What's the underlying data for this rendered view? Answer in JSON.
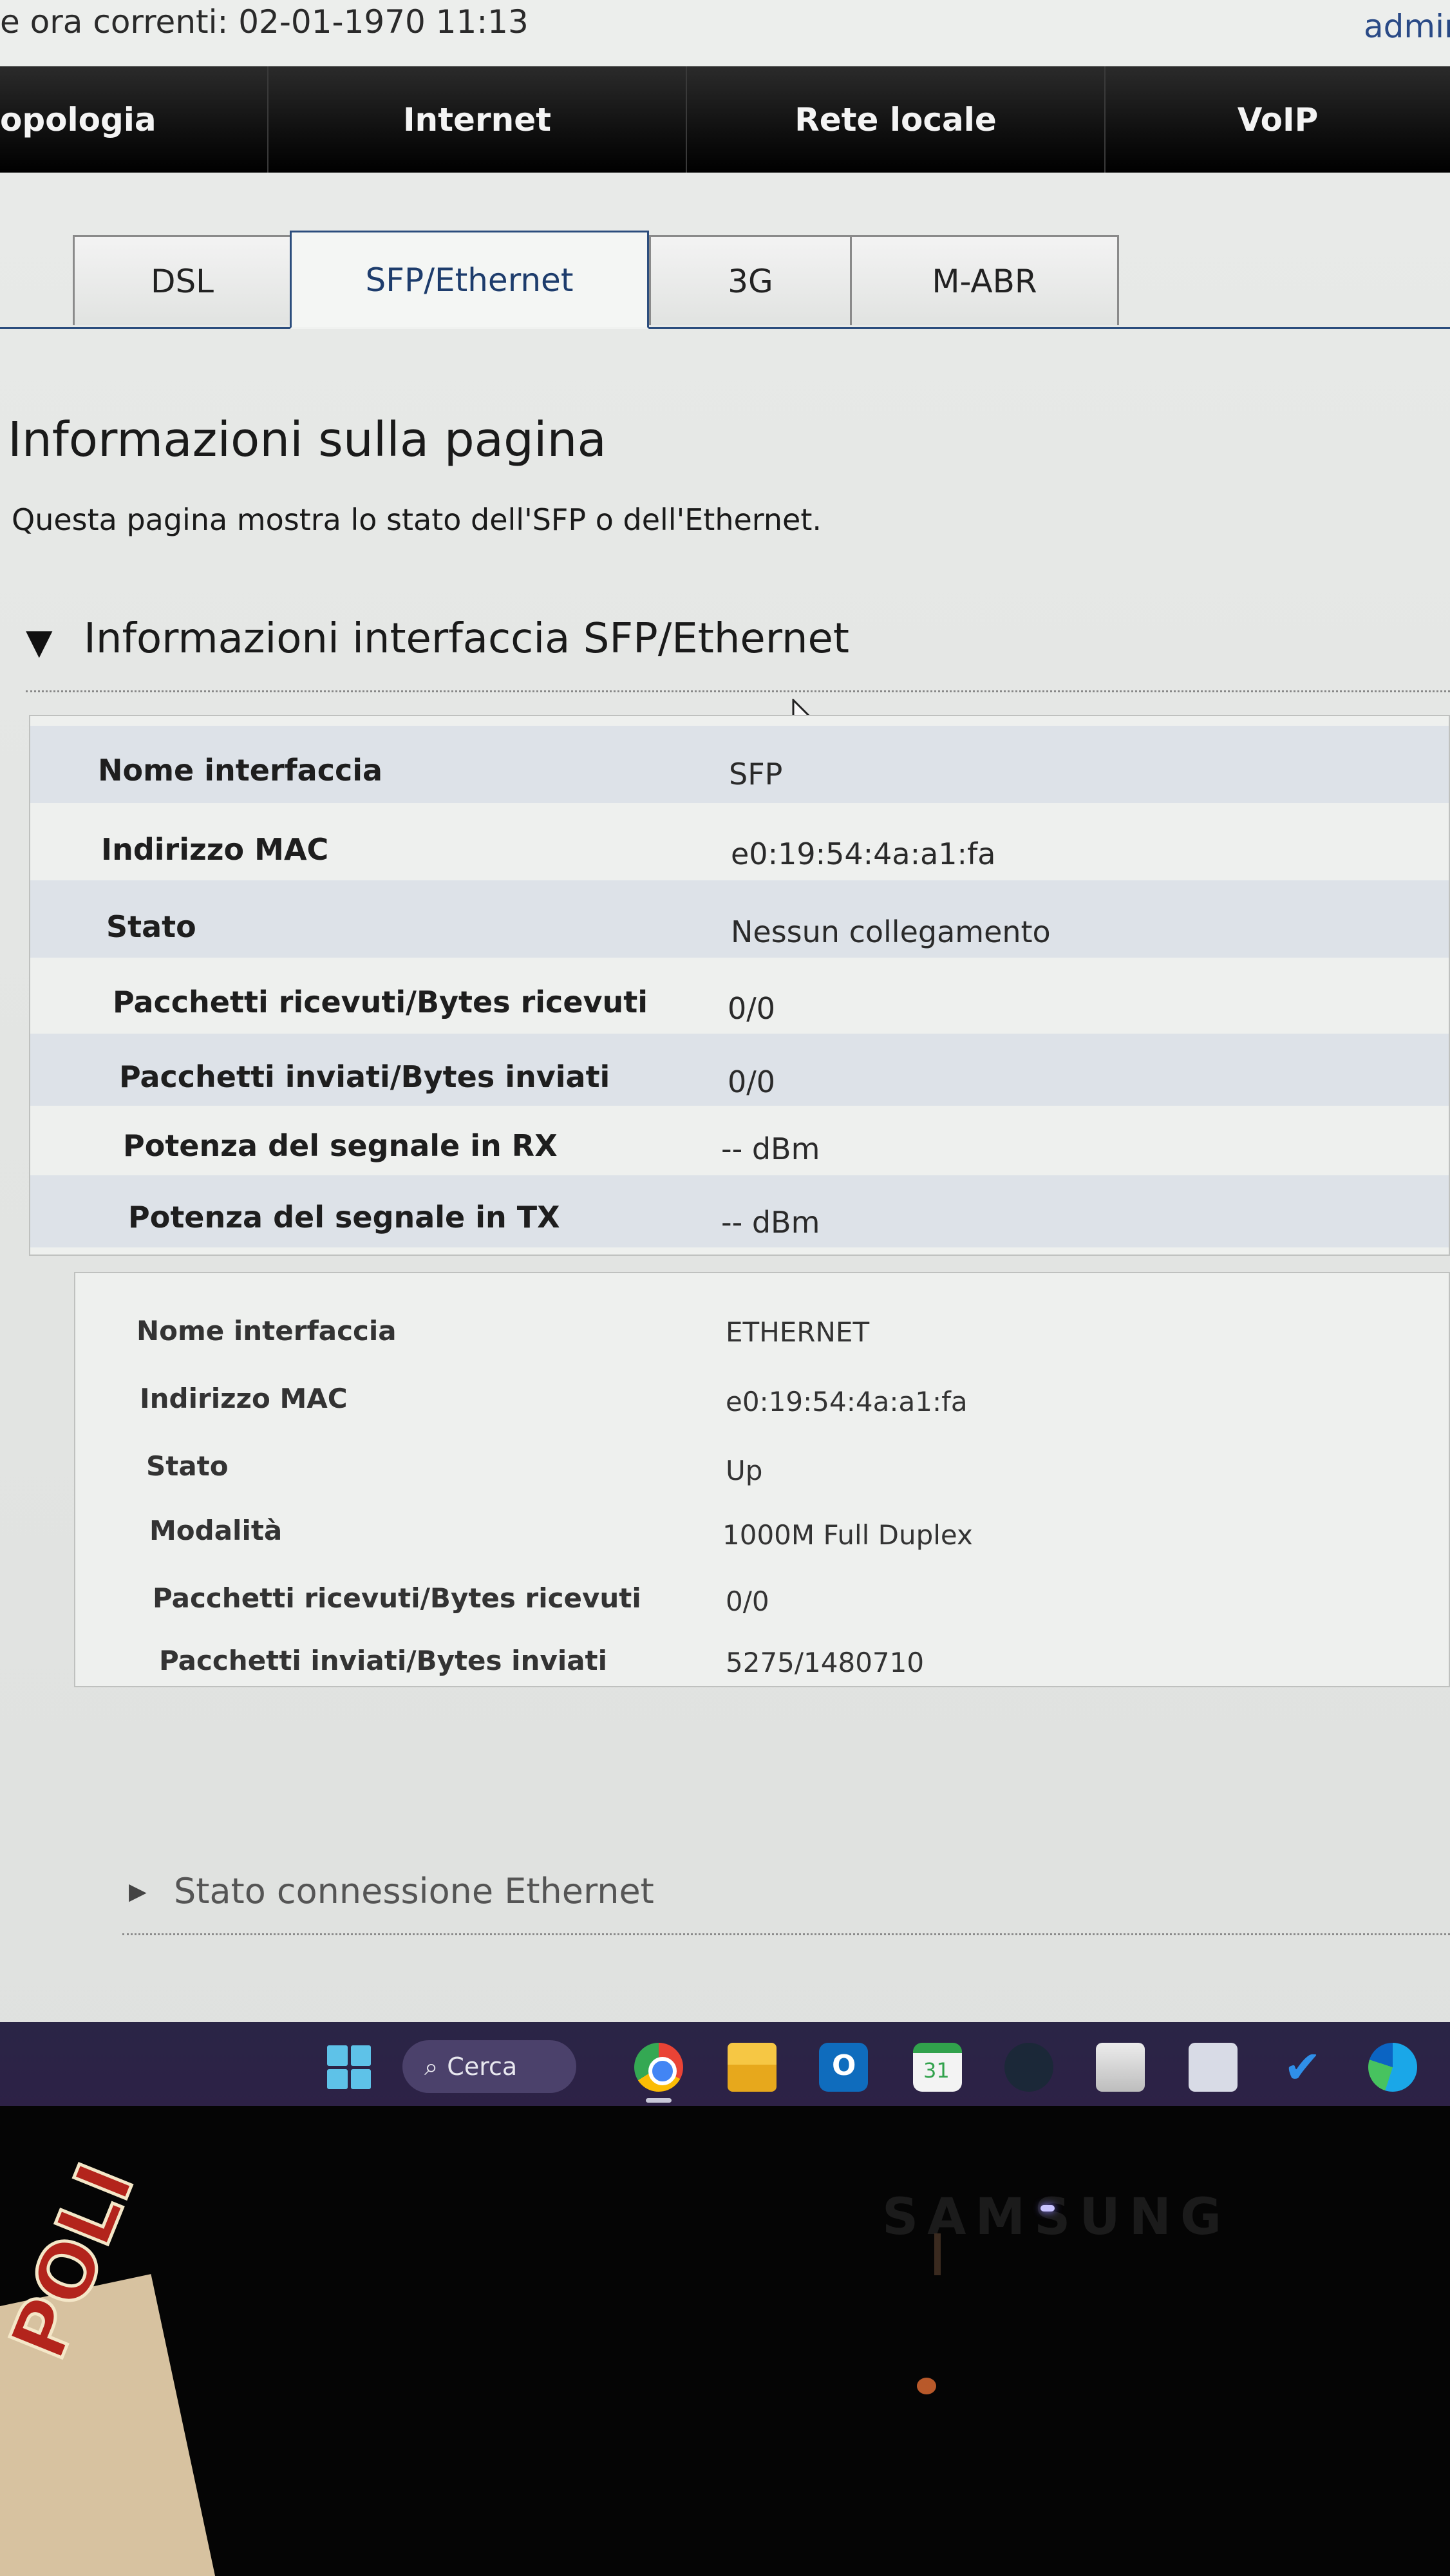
{
  "status_bar": {
    "current_time": "e ora correnti: 02-01-1970 11:13",
    "user": "admin"
  },
  "main_nav": {
    "tabs": [
      "opologia",
      "Internet",
      "Rete locale",
      "VoIP"
    ]
  },
  "sub_tabs": {
    "tabs": [
      "DSL",
      "SFP/Ethernet",
      "3G",
      "M-ABR"
    ],
    "active": "SFP/Ethernet"
  },
  "page": {
    "title": "Informazioni sulla pagina",
    "description": "Questa pagina mostra lo stato dell'SFP o dell'Ethernet."
  },
  "section": {
    "title": "Informazioni interfaccia SFP/Ethernet"
  },
  "sfp_table": [
    {
      "label": "Nome interfaccia",
      "value": "SFP"
    },
    {
      "label": "Indirizzo MAC",
      "value": "e0:19:54:4a:a1:fa"
    },
    {
      "label": "Stato",
      "value": "Nessun collegamento"
    },
    {
      "label": "Pacchetti ricevuti/Bytes ricevuti",
      "value": "0/0"
    },
    {
      "label": "Pacchetti inviati/Bytes inviati",
      "value": "0/0"
    },
    {
      "label": "Potenza del segnale in RX",
      "value": "-- dBm"
    },
    {
      "label": "Potenza del segnale in TX",
      "value": "-- dBm"
    }
  ],
  "ethernet_table": [
    {
      "label": "Nome interfaccia",
      "value": "ETHERNET"
    },
    {
      "label": "Indirizzo MAC",
      "value": "e0:19:54:4a:a1:fa"
    },
    {
      "label": "Stato",
      "value": "Up"
    },
    {
      "label": "Modalità",
      "value": "1000M Full Duplex"
    },
    {
      "label": "Pacchetti ricevuti/Bytes ricevuti",
      "value": "0/0"
    },
    {
      "label": "Pacchetti inviati/Bytes inviati",
      "value": "5275/1480710"
    }
  ],
  "collapsed_section": {
    "title": "Stato connessione Ethernet"
  },
  "taskbar": {
    "search_label": "Cerca",
    "calendar_day": "31",
    "icons": [
      "windows-start-icon",
      "search-icon",
      "chrome-icon",
      "file-explorer-icon",
      "outlook-icon",
      "calendar-icon",
      "steam-icon",
      "microsoft-store-icon",
      "calculator-icon",
      "todo-icon",
      "edge-icon"
    ]
  },
  "monitor": {
    "brand": "SAMSUNG"
  },
  "background": {
    "box_print": "POLI"
  }
}
